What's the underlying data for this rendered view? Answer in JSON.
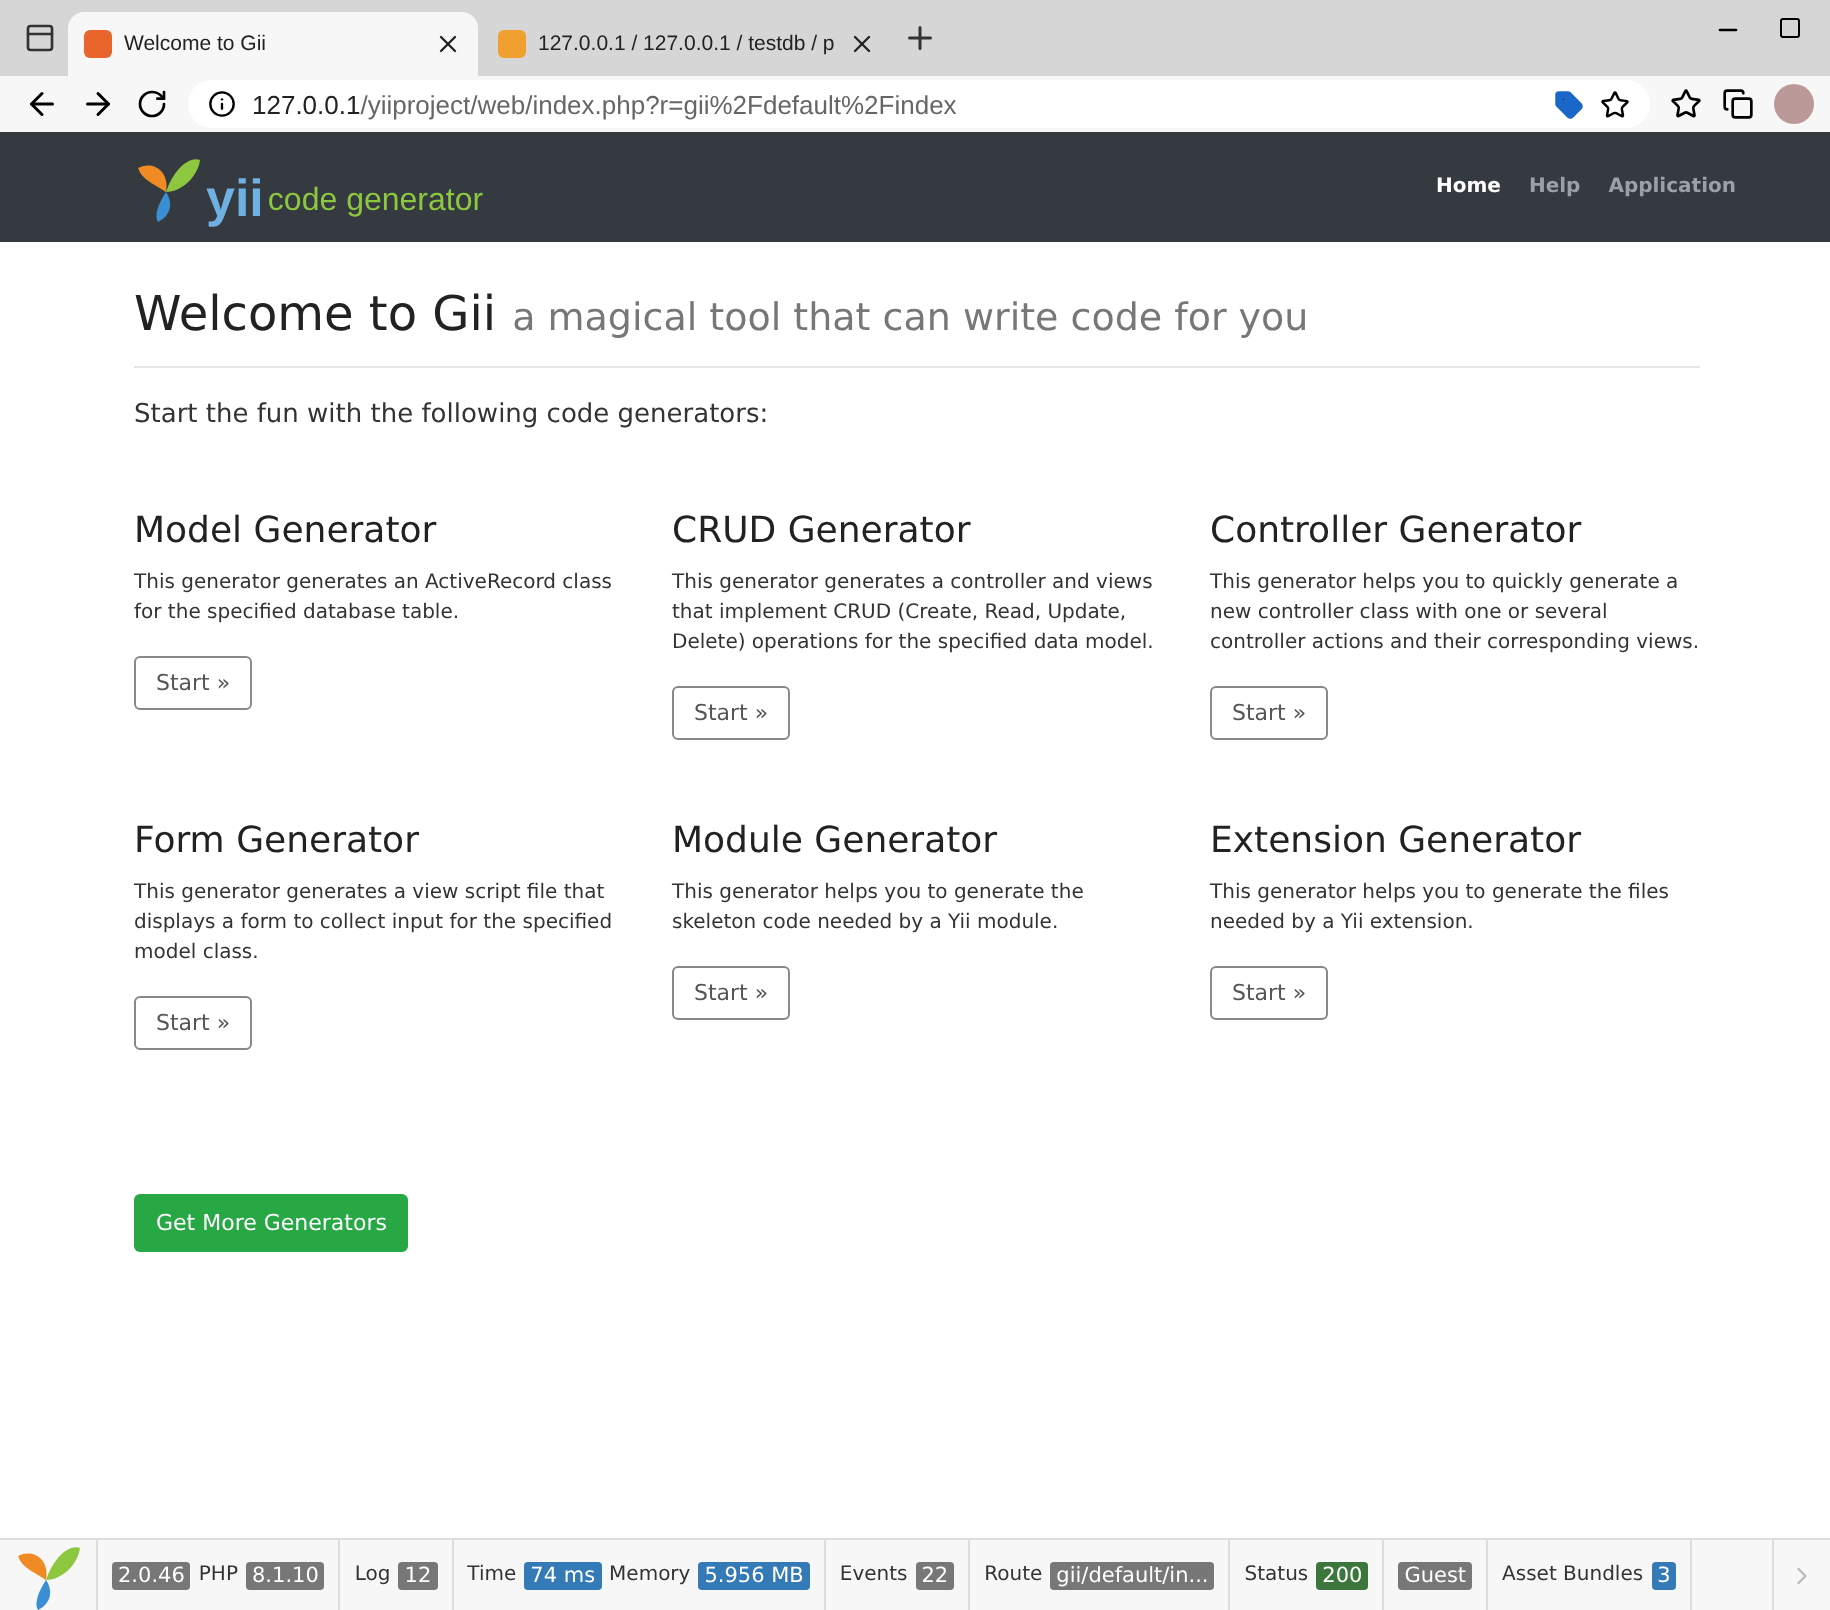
{
  "browser": {
    "tabs": [
      {
        "title": "Welcome to Gii",
        "selected": true
      },
      {
        "title": "127.0.0.1 / 127.0.0.1 / testdb / p",
        "selected": false
      }
    ],
    "url_host": "127.0.0.1",
    "url_path": "/yiiproject/web/index.php?r=gii%2Fdefault%2Findex"
  },
  "navbar": {
    "brand_mark": "yii",
    "brand_text": "code generator",
    "links": [
      {
        "label": "Home",
        "selected": true
      },
      {
        "label": "Help",
        "selected": false
      },
      {
        "label": "Application",
        "selected": false
      }
    ]
  },
  "heading": {
    "title": "Welcome to Gii",
    "subtitle": "a magical tool that can write code for you"
  },
  "intro": "Start the fun with the following code generators:",
  "generators": [
    {
      "name": "Model Generator",
      "description": "This generator generates an ActiveRecord class for the specified database table.",
      "button": "Start »"
    },
    {
      "name": "CRUD Generator",
      "description": "This generator generates a controller and views that implement CRUD (Create, Read, Update, Delete) operations for the specified data model.",
      "button": "Start »"
    },
    {
      "name": "Controller Generator",
      "description": "This generator helps you to quickly generate a new controller class with one or several controller actions and their corresponding views.",
      "button": "Start »"
    },
    {
      "name": "Form Generator",
      "description": "This generator generates a view script file that displays a form to collect input for the specified model class.",
      "button": "Start »"
    },
    {
      "name": "Module Generator",
      "description": "This generator helps you to generate the skeleton code needed by a Yii module.",
      "button": "Start »"
    },
    {
      "name": "Extension Generator",
      "description": "This generator helps you to generate the files needed by a Yii extension.",
      "button": "Start »"
    }
  ],
  "more_button": "Get More Generators",
  "debug_toolbar": [
    {
      "parts": [
        {
          "kind": "badge",
          "text": "2.0.46",
          "color": "#777777"
        },
        {
          "kind": "text",
          "text": "PHP"
        },
        {
          "kind": "badge",
          "text": "8.1.10",
          "color": "#777777"
        }
      ]
    },
    {
      "parts": [
        {
          "kind": "text",
          "text": "Log"
        },
        {
          "kind": "badge",
          "text": "12",
          "color": "#777777"
        }
      ]
    },
    {
      "parts": [
        {
          "kind": "text",
          "text": "Time"
        },
        {
          "kind": "badge",
          "text": "74 ms",
          "color": "#337ab7"
        },
        {
          "kind": "text",
          "text": "Memory"
        },
        {
          "kind": "badge",
          "text": "5.956 MB",
          "color": "#337ab7"
        }
      ]
    },
    {
      "parts": [
        {
          "kind": "text",
          "text": "Events"
        },
        {
          "kind": "badge",
          "text": "22",
          "color": "#777777"
        }
      ]
    },
    {
      "parts": [
        {
          "kind": "text",
          "text": "Route"
        },
        {
          "kind": "badge",
          "text": "gii/default/in...",
          "color": "#777777"
        }
      ]
    },
    {
      "parts": [
        {
          "kind": "text",
          "text": "Status"
        },
        {
          "kind": "badge",
          "text": "200",
          "color": "#3c763d"
        }
      ]
    },
    {
      "parts": [
        {
          "kind": "badge",
          "text": "Guest",
          "color": "#777777"
        }
      ]
    },
    {
      "parts": [
        {
          "kind": "text",
          "text": "Asset Bundles"
        },
        {
          "kind": "badge",
          "text": "3",
          "color": "#337ab7"
        }
      ]
    }
  ]
}
